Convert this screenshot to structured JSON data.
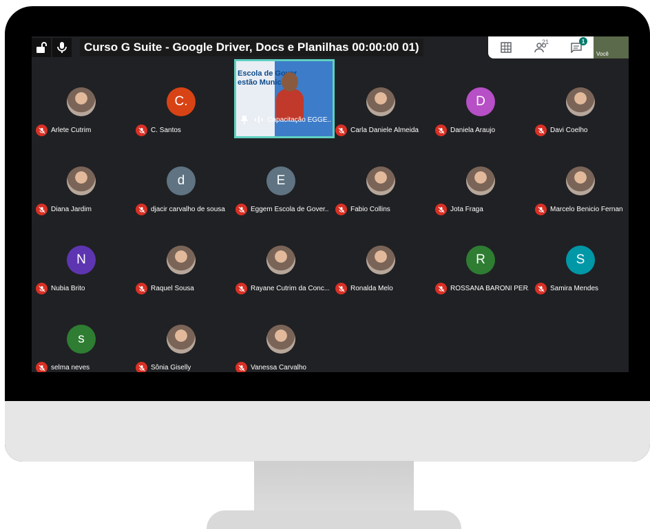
{
  "meeting": {
    "title": "Curso G Suite - Google Driver, Docs e Planilhas 00:00:00  01)",
    "participant_count": "21",
    "chat_unread": "1",
    "self_label": "Você"
  },
  "presenter": {
    "name": "Capacitação EGGE...",
    "sign_text_line1": "Escola de Gover",
    "sign_text_line2": "estão Municip"
  },
  "participants": [
    {
      "name": "Arlete Cutrim",
      "initial": "",
      "color": "",
      "photo": true
    },
    {
      "name": "C. Santos",
      "initial": "C.",
      "color": "#d84315",
      "photo": false
    },
    {
      "name": "Carla Daniele Almeida",
      "initial": "",
      "color": "",
      "photo": true
    },
    {
      "name": "Daniela Araujo",
      "initial": "D",
      "color": "#b74fc6",
      "photo": false
    },
    {
      "name": "Davi Coelho",
      "initial": "",
      "color": "",
      "photo": true
    },
    {
      "name": "Diana Jardim",
      "initial": "",
      "color": "",
      "photo": true
    },
    {
      "name": "djacir carvalho de sousa",
      "initial": "d",
      "color": "#5f7382",
      "photo": false
    },
    {
      "name": "Eggem Escola de Gover...",
      "initial": "E",
      "color": "#5f7382",
      "photo": false
    },
    {
      "name": "Fabio Collins",
      "initial": "",
      "color": "",
      "photo": true
    },
    {
      "name": "Jota Fraga",
      "initial": "",
      "color": "",
      "photo": true
    },
    {
      "name": "Marcelo Benicio Fernan",
      "initial": "",
      "color": "",
      "photo": true
    },
    {
      "name": "Nubia Brito",
      "initial": "N",
      "color": "#5e35b1",
      "photo": false
    },
    {
      "name": "Raquel Sousa",
      "initial": "",
      "color": "",
      "photo": true
    },
    {
      "name": "Rayane Cutrim da Conc...",
      "initial": "",
      "color": "",
      "photo": true
    },
    {
      "name": "Ronalda Melo",
      "initial": "",
      "color": "",
      "photo": true
    },
    {
      "name": "ROSSANA BARONI PER...",
      "initial": "R",
      "color": "#2e7d32",
      "photo": false
    },
    {
      "name": "Samira Mendes",
      "initial": "S",
      "color": "#0097a7",
      "photo": false
    },
    {
      "name": "selma neves",
      "initial": "s",
      "color": "#2e7d32",
      "photo": false
    },
    {
      "name": "Sônia Giselly",
      "initial": "",
      "color": "",
      "photo": true
    },
    {
      "name": "Vanessa Carvalho",
      "initial": "",
      "color": "",
      "photo": true
    }
  ],
  "colors": {
    "mic_off": "#d93025",
    "presenter_border": "#5fd0c0",
    "screen_bg": "#202124"
  },
  "icons": [
    "lock-icon",
    "microphone-icon",
    "grid-layout-icon",
    "people-icon",
    "chat-icon",
    "pin-icon",
    "audio-level-icon",
    "mic-off-icon"
  ]
}
